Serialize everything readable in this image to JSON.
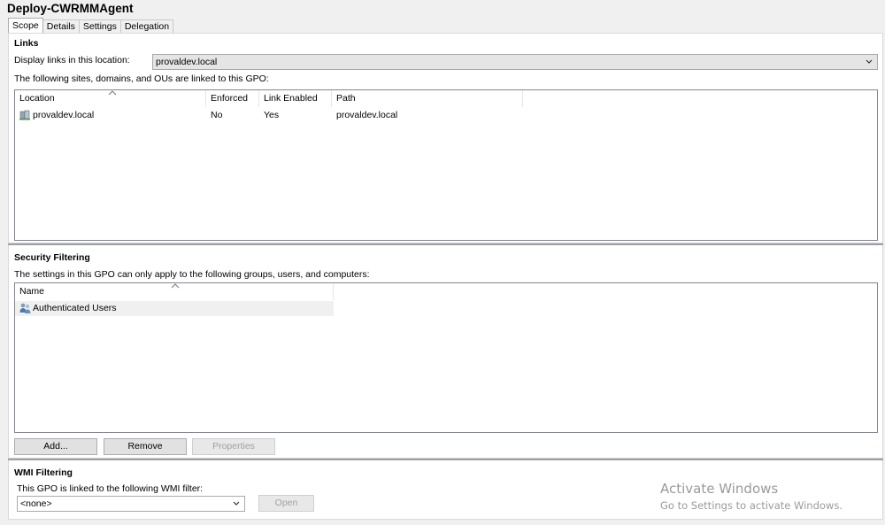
{
  "window": {
    "title": "Deploy-CWRMMAgent"
  },
  "tabs": [
    {
      "label": "Scope",
      "active": true
    },
    {
      "label": "Details"
    },
    {
      "label": "Settings"
    },
    {
      "label": "Delegation"
    }
  ],
  "links": {
    "heading": "Links",
    "location_label": "Display links in this location:",
    "location_value": "provaldev.local",
    "list_caption": "The following sites, domains, and OUs are linked to this GPO:",
    "columns": [
      "Location",
      "Enforced",
      "Link Enabled",
      "Path"
    ],
    "rows": [
      {
        "location": "provaldev.local",
        "enforced": "No",
        "link_enabled": "Yes",
        "path": "provaldev.local",
        "icon": "domain-icon"
      }
    ]
  },
  "security": {
    "heading": "Security Filtering",
    "caption": "The settings in this GPO can only apply to the following groups, users, and computers:",
    "columns": [
      "Name"
    ],
    "rows": [
      {
        "name": "Authenticated Users",
        "icon": "user-group-icon"
      }
    ],
    "buttons": {
      "add": "Add...",
      "remove": "Remove",
      "properties": "Properties"
    }
  },
  "wmi": {
    "heading": "WMI Filtering",
    "caption": "This GPO is linked to the following WMI filter:",
    "filter_value": "<none>",
    "open_label": "Open"
  },
  "watermark": {
    "line1": "Activate Windows",
    "line2": "Go to Settings to activate Windows."
  },
  "colors": {
    "content_bg": "#ffffff",
    "window_bg": "#f0f0f0",
    "border": "#828790"
  }
}
